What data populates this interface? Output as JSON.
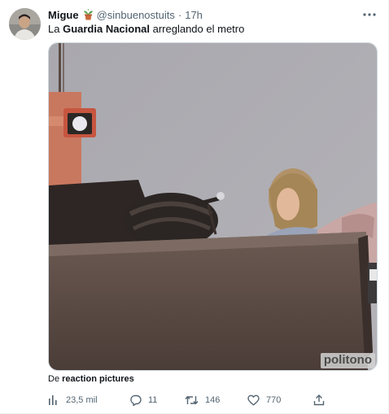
{
  "author": {
    "display_name": "Migue",
    "emoji": "potted-plant-icon",
    "handle": "@sinbuenostuits",
    "separator": "·",
    "time": "17h"
  },
  "tweet": {
    "text_before": "La ",
    "text_bold": "Guardia Nacional",
    "text_after": " arreglando el metro"
  },
  "media": {
    "watermark": "politono"
  },
  "via": {
    "prefix": "De ",
    "link": "reaction pictures"
  },
  "actions": {
    "views": "23,5 mil",
    "replies": "11",
    "retweets": "146",
    "likes": "770"
  },
  "colors": {
    "text_primary": "#0f1419",
    "text_secondary": "#536471",
    "border": "#cfd9de"
  }
}
